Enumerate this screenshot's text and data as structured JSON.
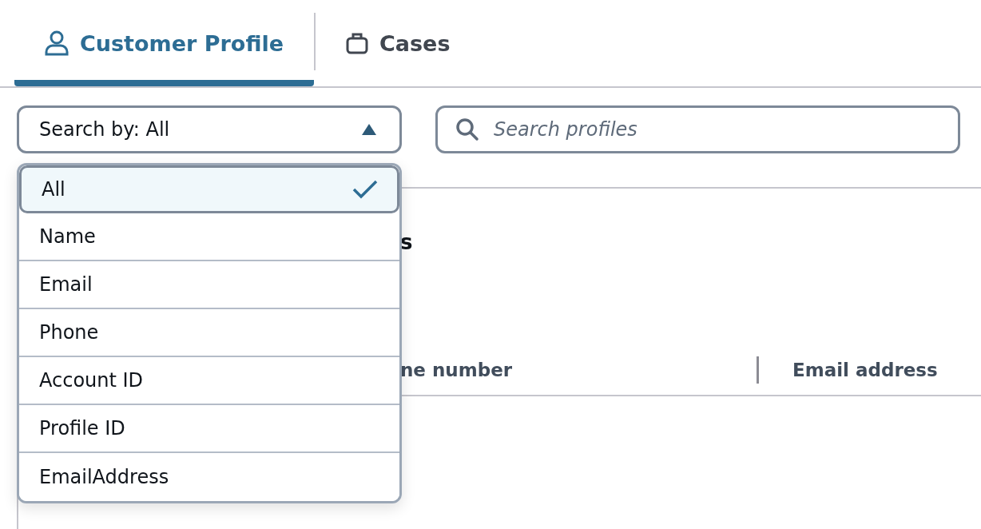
{
  "tabs": [
    {
      "label": "Customer Profile",
      "selected": true
    },
    {
      "label": "Cases",
      "selected": false
    }
  ],
  "search_by": {
    "label": "Search by: All",
    "expanded": true,
    "options": [
      {
        "label": "All",
        "selected": true
      },
      {
        "label": "Name",
        "selected": false
      },
      {
        "label": "Email",
        "selected": false
      },
      {
        "label": "Phone",
        "selected": false
      },
      {
        "label": "Account ID",
        "selected": false
      },
      {
        "label": "Profile ID",
        "selected": false
      },
      {
        "label": "EmailAddress",
        "selected": false
      }
    ]
  },
  "search": {
    "placeholder": "Search profiles"
  },
  "results": {
    "heading": "s",
    "columns": [
      "ne number",
      "Email address"
    ]
  }
}
